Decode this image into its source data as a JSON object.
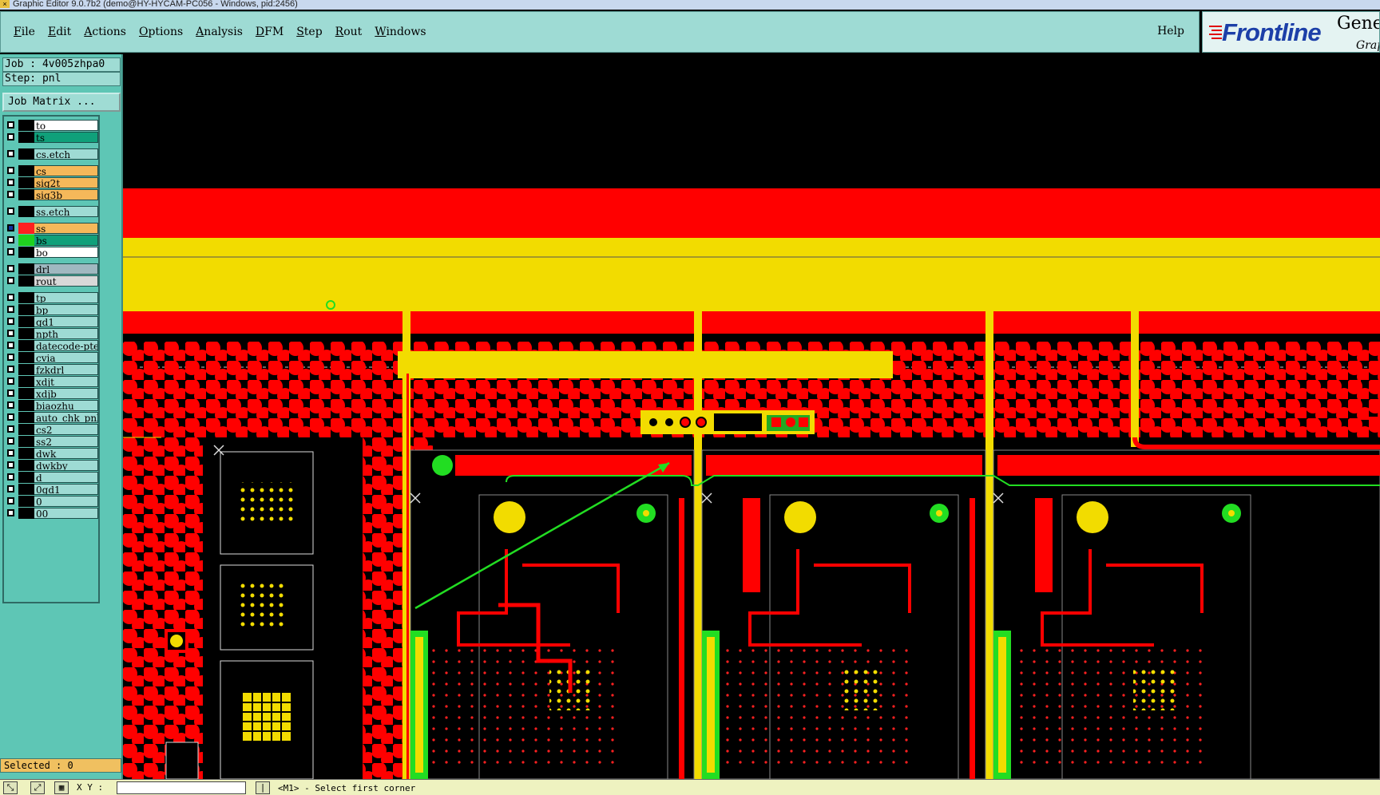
{
  "window": {
    "title": "Graphic Editor 9.0.7b2 (demo@HY-HYCAM-PC056 - Windows, pid:2456)"
  },
  "menu": {
    "items": [
      "File",
      "Edit",
      "Actions",
      "Options",
      "Analysis",
      "DFM",
      "Step",
      "Rout",
      "Windows"
    ],
    "help": "Help"
  },
  "brand": {
    "logo": "Frontline",
    "product": "Gene",
    "subtitle": "Grap"
  },
  "job": {
    "job_line": "Job : 4v005zhpa0",
    "step_line": "Step: pnl",
    "matrix_button": "Job Matrix ..."
  },
  "layers": [
    {
      "name": "to",
      "bg": "#ffffff",
      "swatch": "#000000"
    },
    {
      "name": "ts",
      "bg": "#10a07a",
      "swatch": "#000000"
    },
    {
      "name": "cs.etch",
      "bg": "#9edbd4",
      "swatch": "#000000"
    },
    {
      "name": "cs",
      "bg": "#f5b85a",
      "swatch": "#000000"
    },
    {
      "name": "sig2t",
      "bg": "#f5b85a",
      "swatch": "#000000"
    },
    {
      "name": "sig3b",
      "bg": "#f5b85a",
      "swatch": "#000000"
    },
    {
      "name": "ss.etch",
      "bg": "#9edbd4",
      "swatch": "#000000"
    },
    {
      "name": "ss",
      "bg": "#f5b85a",
      "swatch": "#ff2020",
      "active": true
    },
    {
      "name": "bs",
      "bg": "#10a07a",
      "swatch": "#20d020"
    },
    {
      "name": "bo",
      "bg": "#ffffff",
      "swatch": "#000000"
    },
    {
      "name": "drl",
      "bg": "#a0b8c0",
      "swatch": "#000000"
    },
    {
      "name": "rout",
      "bg": "#d8d8d8",
      "swatch": "#000000"
    },
    {
      "name": "tp",
      "bg": "#9edbd4",
      "swatch": "#000000"
    },
    {
      "name": "bp",
      "bg": "#9edbd4",
      "swatch": "#000000"
    },
    {
      "name": "gd1",
      "bg": "#9edbd4",
      "swatch": "#000000"
    },
    {
      "name": "npth",
      "bg": "#9edbd4",
      "swatch": "#000000"
    },
    {
      "name": "datecode-pte",
      "bg": "#9edbd4",
      "swatch": "#000000"
    },
    {
      "name": "cvia",
      "bg": "#9edbd4",
      "swatch": "#000000"
    },
    {
      "name": "fzkdrl",
      "bg": "#9edbd4",
      "swatch": "#000000"
    },
    {
      "name": "xdjt",
      "bg": "#9edbd4",
      "swatch": "#000000"
    },
    {
      "name": "xdjb",
      "bg": "#9edbd4",
      "swatch": "#000000"
    },
    {
      "name": "biaozhu",
      "bg": "#9edbd4",
      "swatch": "#000000"
    },
    {
      "name": "auto_chk_pnl",
      "bg": "#9edbd4",
      "swatch": "#000000"
    },
    {
      "name": "cs2",
      "bg": "#9edbd4",
      "swatch": "#000000"
    },
    {
      "name": "ss2",
      "bg": "#9edbd4",
      "swatch": "#000000"
    },
    {
      "name": "dwk",
      "bg": "#9edbd4",
      "swatch": "#000000"
    },
    {
      "name": "dwkby",
      "bg": "#9edbd4",
      "swatch": "#000000"
    },
    {
      "name": "d",
      "bg": "#9edbd4",
      "swatch": "#000000"
    },
    {
      "name": "0gd1",
      "bg": "#9edbd4",
      "swatch": "#000000"
    },
    {
      "name": "0",
      "bg": "#9edbd4",
      "swatch": "#000000"
    },
    {
      "name": "00",
      "bg": "#9edbd4",
      "swatch": "#000000"
    }
  ],
  "selected": "Selected : 0",
  "status": {
    "xy_label": "X Y :",
    "xy_value": "",
    "message": "<M1> - Select first corner"
  },
  "colors": {
    "panel_teal": "#5ec6b5",
    "menubar": "#9edbd4",
    "copper_red": "#ff0000",
    "solder_yellow": "#f2dc00",
    "silk_green": "#22dd22"
  },
  "icons": {
    "tool_1": "select-tool-icon",
    "tool_2": "zoom-tool-icon",
    "tool_3": "grid-icon",
    "tool_4": "snap-icon"
  }
}
